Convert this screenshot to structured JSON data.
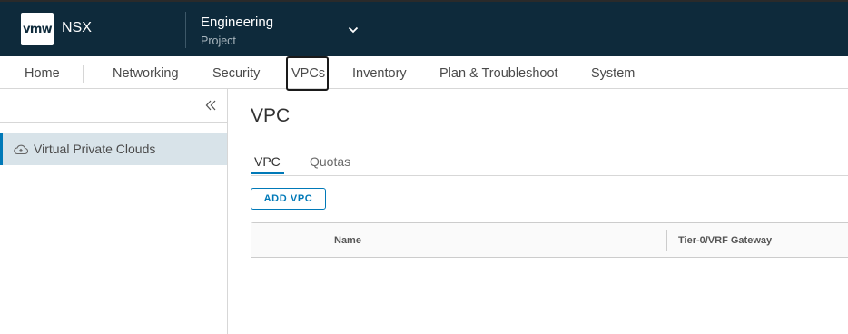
{
  "header": {
    "logo_text": "vmw",
    "product_name": "NSX",
    "project_name": "Engineering",
    "project_type": "Project",
    "dropdown_icon": "chevron-down-icon"
  },
  "nav": {
    "items": [
      {
        "label": "Home"
      },
      {
        "label": "Networking"
      },
      {
        "label": "Security"
      },
      {
        "label": "VPCs",
        "active": true
      },
      {
        "label": "Inventory"
      },
      {
        "label": "Plan & Troubleshoot"
      },
      {
        "label": "System"
      }
    ]
  },
  "sidebar": {
    "collapse_icon": "double-chevron-left-icon",
    "items": [
      {
        "label": "Virtual Private Clouds",
        "icon": "cloud-icon",
        "selected": true
      }
    ]
  },
  "main": {
    "title": "VPC",
    "tabs": [
      {
        "label": "VPC",
        "active": true
      },
      {
        "label": "Quotas"
      }
    ],
    "add_button_label": "ADD VPC",
    "table": {
      "columns": [
        "Name",
        "Tier-0/VRF Gateway"
      ],
      "rows": []
    }
  },
  "colors": {
    "header_bg": "#0e2a3b",
    "accent": "#0079b8",
    "sidebar_selected_bg": "#d8e3e9"
  }
}
